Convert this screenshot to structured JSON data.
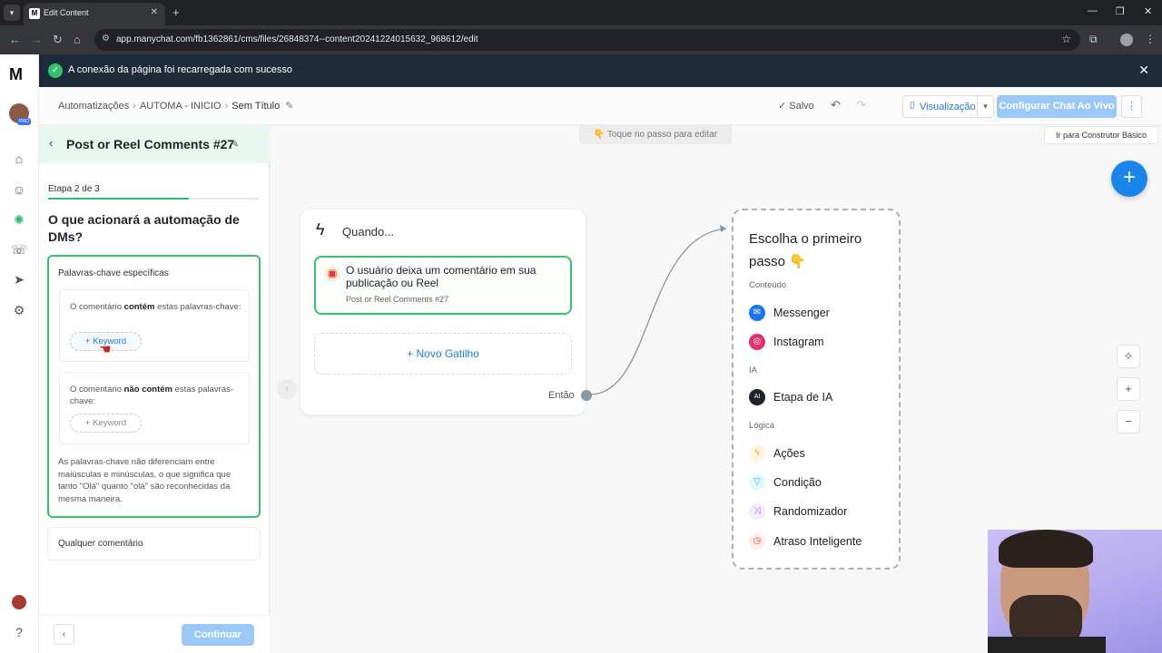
{
  "browser": {
    "tab_title": "Edit Content",
    "url": "app.manychat.com/fb1362861/cms/files/26848374--content20241224015632_968612/edit"
  },
  "app": {
    "logo": "M"
  },
  "banner": {
    "message": "A conexão da página foi recarregada com sucesso"
  },
  "breadcrumb": {
    "items": [
      "Automatizações",
      "AUTOMA - INICIO",
      "Sem Título"
    ]
  },
  "toolbar": {
    "saved_label": "Salvo",
    "preview_label": "Visualização",
    "live_chat_label": "Configurar Chat Ao Vivo",
    "basic_builder_tip": "Ir para Construtor Básico"
  },
  "panel": {
    "title": "Post or Reel Comments #27",
    "step_label": "Etapa 2 de 3",
    "progress": 0.67,
    "question": "O que acionará a automação de DMs?",
    "specific": {
      "title": "Palavras-chave específicas",
      "contains_pre": "O comentário ",
      "contains_bold": "contém",
      "contains_post": " estas palavras-chave:",
      "not_contains_pre": "O comentário ",
      "not_contains_bold": "não contém",
      "not_contains_post": " estas palavras-chave:",
      "keyword_button": "+ Keyword",
      "note": "As palavras-chave não diferenciam entre maiúsculas e minúsculas, o que significa que tanto \"Olá\" quanto \"olá\" são reconhecidas da mesma maneira."
    },
    "any_comment": "Qualquer comentário",
    "continue_label": "Continuar"
  },
  "canvas": {
    "hint": "👇 Toque no passo para editar",
    "trigger_node": {
      "title": "Quando...",
      "trigger_text": "O usuário deixa um comentário em sua publicação ou Reel",
      "trigger_sub": "Post or Reel Comments #27",
      "new_trigger": "+ Novo Gatilho",
      "then_label": "Então"
    },
    "first_step": {
      "title": "Escolha o primeiro passo 👇",
      "sections": [
        {
          "label": "Conteúdo",
          "items": [
            {
              "label": "Messenger",
              "icon": "messenger-icon",
              "color": "#1877f2"
            },
            {
              "label": "Instagram",
              "icon": "instagram-icon",
              "color": "#e1306c"
            }
          ]
        },
        {
          "label": "IA",
          "items": [
            {
              "label": "Etapa de IA",
              "icon": "ai-icon",
              "color": "#1f2328"
            }
          ]
        },
        {
          "label": "Lógica",
          "items": [
            {
              "label": "Ações",
              "icon": "bolt-icon",
              "color": "#f5a623"
            },
            {
              "label": "Condição",
              "icon": "filter-icon",
              "color": "#26c6da"
            },
            {
              "label": "Randomizador",
              "icon": "shuffle-icon",
              "color": "#a66cf0"
            },
            {
              "label": "Atraso Inteligente",
              "icon": "clock-icon",
              "color": "#e5533d"
            }
          ]
        }
      ]
    }
  },
  "colors": {
    "accent_blue": "#1a86ea",
    "success_green": "#37c46c",
    "banner_bg": "#1d2a3a"
  }
}
